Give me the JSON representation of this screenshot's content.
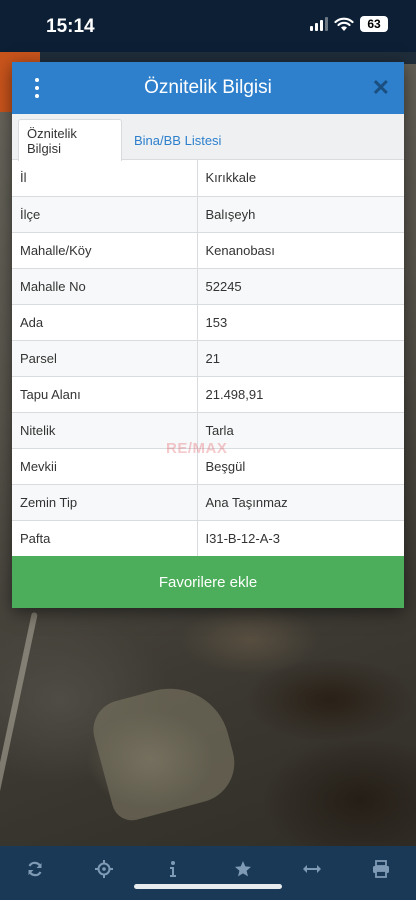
{
  "status_bar": {
    "time": "15:14",
    "battery": "63"
  },
  "dialog": {
    "title": "Öznitelik Bilgisi",
    "tabs": [
      {
        "label": "Öznitelik Bilgisi",
        "active": true
      },
      {
        "label": "Bina/BB Listesi",
        "active": false
      }
    ],
    "rows": [
      {
        "key": "İl",
        "value": "Kırıkkale"
      },
      {
        "key": "İlçe",
        "value": "Balışeyh"
      },
      {
        "key": "Mahalle/Köy",
        "value": "Kenanobası"
      },
      {
        "key": "Mahalle No",
        "value": "52245"
      },
      {
        "key": "Ada",
        "value": "153"
      },
      {
        "key": "Parsel",
        "value": "21"
      },
      {
        "key": "Tapu Alanı",
        "value": "21.498,91"
      },
      {
        "key": "Nitelik",
        "value": "Tarla"
      },
      {
        "key": "Mevkii",
        "value": "Beşgül"
      },
      {
        "key": "Zemin Tip",
        "value": "Ana Taşınmaz"
      },
      {
        "key": "Pafta",
        "value": "I31-B-12-A-3"
      }
    ],
    "favorite_button": "Favorilere ekle"
  },
  "watermark": "RE/MAX",
  "toolbar": {
    "icons": [
      "refresh-icon",
      "locate-icon",
      "info-icon",
      "star-icon",
      "measure-icon",
      "print-icon"
    ]
  },
  "colors": {
    "header_blue": "#2e80cc",
    "button_green": "#4cae5a",
    "toolbar_navy": "#1a3956",
    "status_bar": "#0c1f35"
  }
}
